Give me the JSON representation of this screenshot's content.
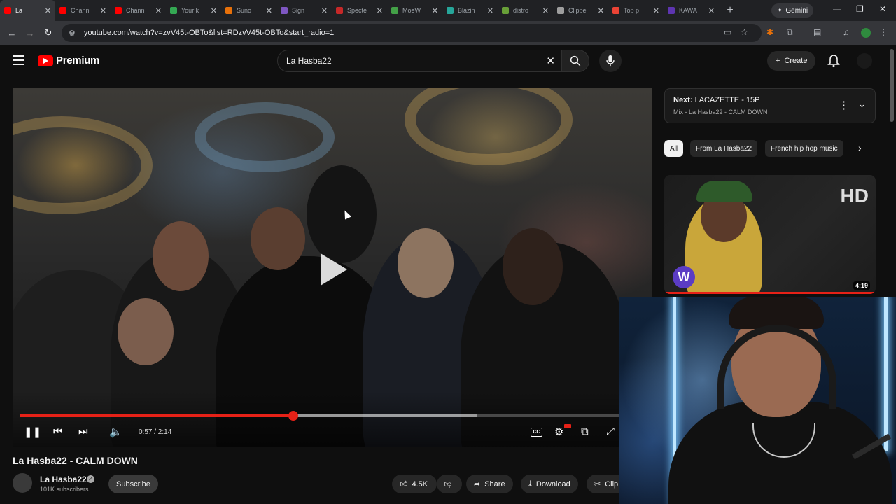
{
  "browser": {
    "tabs": [
      {
        "label": "La",
        "color": "#ff0000",
        "active": true
      },
      {
        "label": "Chann",
        "color": "#ff0000"
      },
      {
        "label": "Chann",
        "color": "#ff0000"
      },
      {
        "label": "Your k",
        "color": "#34a853"
      },
      {
        "label": "Suno",
        "color": "#e8710a"
      },
      {
        "label": "Sign i",
        "color": "#7e57c2"
      },
      {
        "label": "Specte",
        "color": "#c62828"
      },
      {
        "label": "MoeW",
        "color": "#43a047"
      },
      {
        "label": "Blazin",
        "color": "#26a69a"
      },
      {
        "label": "distro",
        "color": "#689f38"
      },
      {
        "label": "Clippe",
        "color": "#9e9e9e"
      },
      {
        "label": "Top p",
        "color": "#ea4335"
      },
      {
        "label": "KAWA",
        "color": "#5e35b1"
      }
    ],
    "gemini_label": "Gemini",
    "url": "youtube.com/watch?v=zvV45t-OBTo&list=RDzvV45t-OBTo&start_radio=1"
  },
  "youtube": {
    "brand": "Premium",
    "search_value": "La Hasba22",
    "create_label": "Create"
  },
  "player": {
    "time": "0:57 / 2:14",
    "progress_fraction": 0.4542,
    "buffered_fraction": 0.76
  },
  "video": {
    "title": "La Hasba22 - CALM DOWN",
    "channel": "La Hasba22",
    "subscribers": "101K subscribers",
    "subscribe_label": "Subscribe",
    "likes": "4.5K",
    "share_label": "Share",
    "download_label": "Download",
    "clip_label": "Clip"
  },
  "sidebar": {
    "next_prefix": "Next:",
    "next_title": "LACAZETTE - 15P",
    "next_subtitle": "Mix - La Hasba22 - CALM DOWN",
    "chips": [
      "All",
      "From La Hasba22",
      "French hip hop music"
    ],
    "thumb_badge": "HD",
    "thumb_duration": "4:19"
  },
  "colors": {
    "accent": "#e62117",
    "bg": "#0f0f0f"
  }
}
